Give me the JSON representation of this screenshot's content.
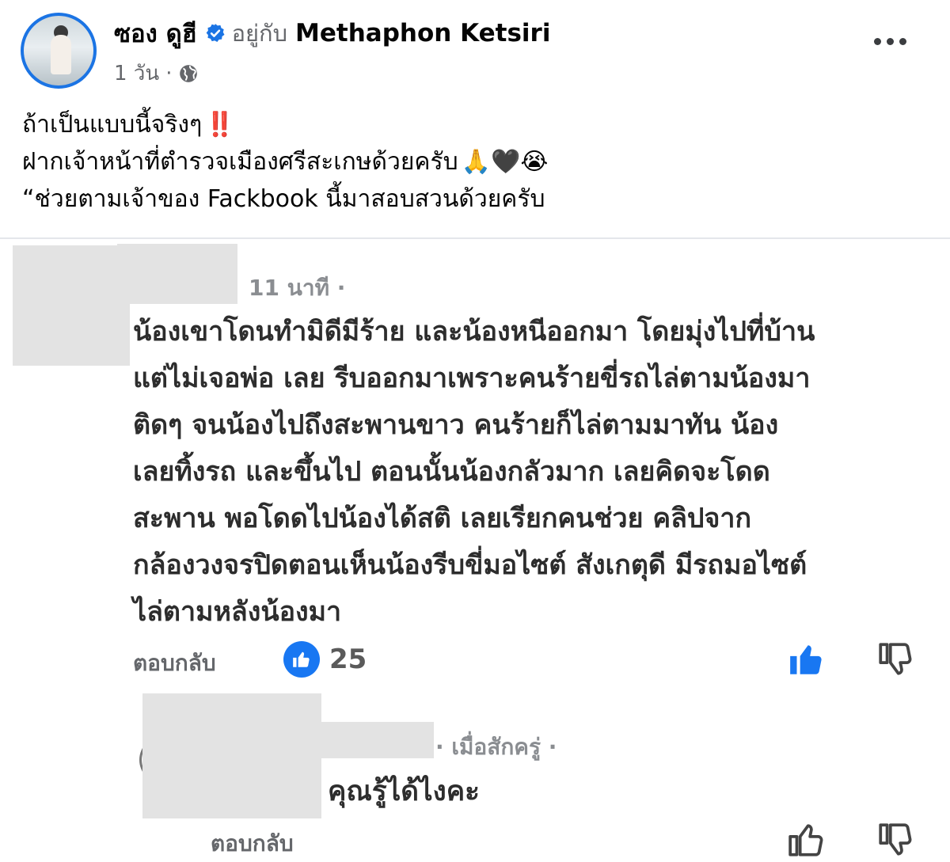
{
  "post": {
    "author": "ซอง ดูฮี",
    "with_text": "อยู่กับ",
    "tagged_user": "Methaphon Ketsiri",
    "time": "1 วัน",
    "separator": "·",
    "body_lines": [
      "ถ้าเป็นแบบนี้จริงๆ",
      "ฝากเจ้าหน้าที่ตำรวจเมืองศรีสะเกษด้วยครับ",
      "“ช่วยตาม￼เจ้าของ￼￼ Fackbook นี้มาสอบสวนด้วยครับ"
    ],
    "emoji_line1": "‼️",
    "emoji_line2": "🙏🖤😭"
  },
  "comment": {
    "time": "11 นาที",
    "time_dot": "·",
    "lines": [
      "น้องเขาโดนทำมิดีมีร้าย และน้องหนีออกมา โดยมุ่งไปที่บ้าน",
      "แต่ไม่เจอพ่อ เลย รีบออกมาเพราะคนร้ายขี่รถไล่ตามน้องมา",
      "ติดๆ จนน้องไปถึงสะพานขาว คนร้ายก็ไล่ตามมาทัน น้อง",
      "เลยทิ้งรถ และขึ้นไป ตอนนั้นน้องกลัวมาก เลยคิดจะโดด",
      "สะพาน พอโดดไปน้องได้สติ เลยเรียกคนช่วย คลิปจาก",
      "กล้องวงจรปิดตอนเห็นน้องรีบขี่มอไซต์ สังเกตุดี มีรถมอไซต์",
      "ไล่ตามหลังน้องมา"
    ],
    "reply_label": "ตอบกลับ",
    "reaction_count": "25"
  },
  "reply": {
    "time_prefix": "·",
    "time": "เมื่อสักครู่",
    "time_dot": "·",
    "text": "คุณรู้ได้ไงคะ",
    "reply_label": "ตอบกลับ"
  },
  "colors": {
    "accent": "#1877f2",
    "verified": "#1b74e4",
    "muted": "#65676b"
  },
  "icons": {
    "verified": "verified-badge-icon",
    "audience": "globe-icon",
    "more": "more-options-icon",
    "like": "thumbs-up-icon",
    "dislike": "thumbs-down-icon"
  }
}
